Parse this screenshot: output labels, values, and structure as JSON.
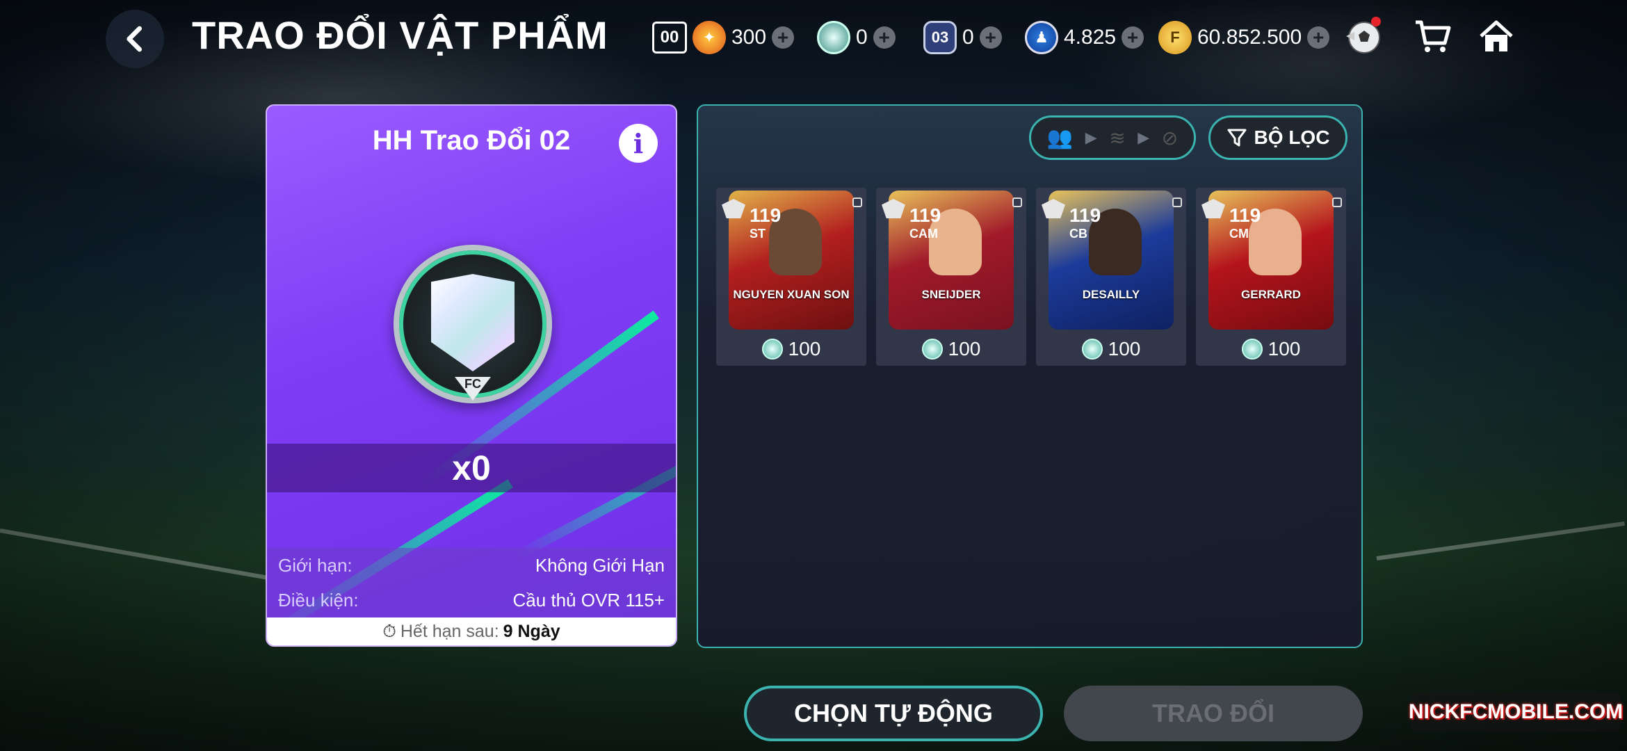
{
  "header": {
    "title": "TRAO ĐỔI VẬT PHẨM",
    "season_tag": "00",
    "currencies": [
      {
        "icon": "gold-emblem-icon",
        "value": "300"
      },
      {
        "icon": "silver-shield-icon",
        "value": "0"
      },
      {
        "icon": "ticket-03-icon",
        "value": "0"
      },
      {
        "icon": "player-token-icon",
        "value": "4.825"
      },
      {
        "icon": "fc-coin-icon",
        "value": "60.852.500"
      }
    ],
    "ticket_label": "03",
    "has_notification": true
  },
  "item": {
    "title": "HH Trao Đổi 02",
    "quantity": "x0",
    "rows": [
      {
        "label": "Giới hạn:",
        "value": "Không Giới Hạn"
      },
      {
        "label": "Điều kiện:",
        "value": "Cầu thủ OVR 115+"
      }
    ],
    "expiry_label": "Hết hạn sau:",
    "expiry_value": "9 Ngày",
    "logo_text": "FC"
  },
  "panel": {
    "filter_label": "BỘ LỌC",
    "players": [
      {
        "ovr": "119",
        "pos": "ST",
        "name": "NGUYEN XUAN SON",
        "cost": "100",
        "color": "#b21f1f"
      },
      {
        "ovr": "119",
        "pos": "CAM",
        "name": "SNEIJDER",
        "cost": "100",
        "color": "#a11a2a"
      },
      {
        "ovr": "119",
        "pos": "CB",
        "name": "DESAILLY",
        "cost": "100",
        "color": "#1c3b9a"
      },
      {
        "ovr": "119",
        "pos": "CM",
        "name": "GERRARD",
        "cost": "100",
        "color": "#b4141c"
      }
    ]
  },
  "footer": {
    "auto_label": "CHỌN TỰ ĐỘNG",
    "trade_label": "TRAO ĐỔI",
    "watermark": "NICKFCMOBILE.COM"
  }
}
